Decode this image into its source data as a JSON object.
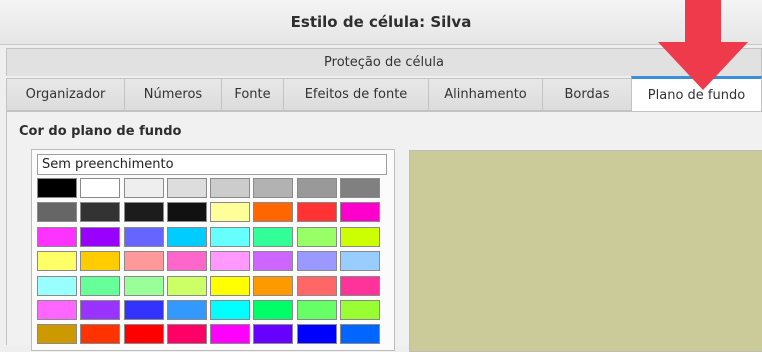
{
  "window": {
    "title": "Estilo de célula: Silva"
  },
  "tabs_row1": [
    {
      "label": "Proteção de célula"
    }
  ],
  "tabs_row2": [
    {
      "label": "Organizador"
    },
    {
      "label": "Números"
    },
    {
      "label": "Fonte"
    },
    {
      "label": "Efeitos de fonte"
    },
    {
      "label": "Alinhamento"
    },
    {
      "label": "Bordas"
    },
    {
      "label": "Plano de fundo",
      "active": true
    }
  ],
  "background": {
    "section_label": "Cor do plano de fundo",
    "none_option": "Sem preenchimento",
    "preview_color": "#cbcb9a",
    "palette_colors": [
      [
        "#000000",
        "#ffffff",
        "#eeeeee",
        "#dddddd",
        "#cccccc",
        "#b2b2b2",
        "#999999",
        "#808080"
      ],
      [
        "#666666",
        "#333333",
        "#1c1c1c",
        "#111111",
        "#ffff99",
        "#ff6600",
        "#ff3333",
        "#ff00cc"
      ],
      [
        "#ff33ff",
        "#9900ff",
        "#6666ff",
        "#00ccff",
        "#66ffff",
        "#33ff99",
        "#99ff66",
        "#ccff00"
      ],
      [
        "#ffff66",
        "#ffcc00",
        "#ff9999",
        "#ff66cc",
        "#ff99ff",
        "#cc66ff",
        "#9999ff",
        "#99ccff"
      ],
      [
        "#99ffff",
        "#66ff99",
        "#99ff99",
        "#ccff66",
        "#ffff00",
        "#ff9900",
        "#ff6666",
        "#ff3399"
      ],
      [
        "#ff66ff",
        "#9933ff",
        "#3333ff",
        "#3399ff",
        "#00ffff",
        "#00ff66",
        "#66ff66",
        "#99ff33"
      ],
      [
        "#cc9900",
        "#ff3300",
        "#ff0000",
        "#ff0066",
        "#ff00ff",
        "#6600ff",
        "#0000ff",
        "#0066ff"
      ]
    ]
  },
  "annotation": {
    "arrow_color": "#ef3a4c"
  }
}
